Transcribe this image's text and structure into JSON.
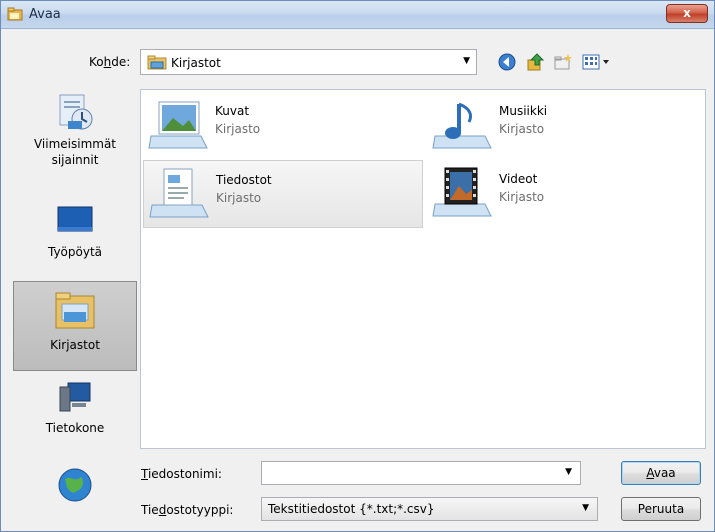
{
  "window": {
    "title": "Avaa",
    "close": "x"
  },
  "toolbar": {
    "location_label": "Kohde:",
    "location_value": "Kirjastot"
  },
  "nav": {
    "items": [
      {
        "label": "Viimeisimmät sijainnit"
      },
      {
        "label": "Työpöytä"
      },
      {
        "label": "Kirjastot"
      },
      {
        "label": "Tietokone"
      }
    ]
  },
  "libraries": [
    {
      "name": "Kuvat",
      "type": "Kirjasto"
    },
    {
      "name": "Musiikki",
      "type": "Kirjasto"
    },
    {
      "name": "Tiedostot",
      "type": "Kirjasto"
    },
    {
      "name": "Videot",
      "type": "Kirjasto"
    }
  ],
  "bottom": {
    "filename_label": "Tiedostonimi:",
    "filename_value": "",
    "filetype_label": "Tiedostotyyppi:",
    "filetype_value": "Tekstitiedostot {*.txt;*.csv}",
    "open_button": "Avaa",
    "cancel_button": "Peruuta"
  }
}
